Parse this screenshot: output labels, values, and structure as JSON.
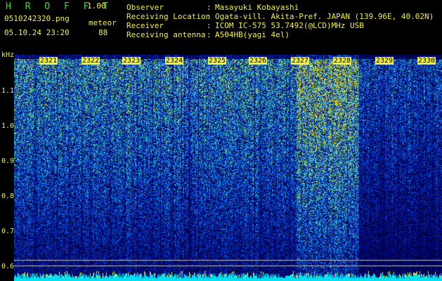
{
  "header": {
    "title": "H R O F F T",
    "version": "1.00",
    "filename": "0510242320.png",
    "mode": "meteor",
    "datetime": "05.10.24 23:20",
    "count": "88",
    "info": [
      {
        "key": "Observer",
        "value": "Masayuki Kobayashi"
      },
      {
        "key": "Receiving Location",
        "value": "Ogata-vill. Akita-Pref. JAPAN (139.96E, 40.02N)"
      },
      {
        "key": "Receiver",
        "value": "ICOM IC-575 53.7492(@LCD)MHz USB"
      },
      {
        "key": "Receiving antenna",
        "value": "A504HB(yagi 4el)"
      }
    ],
    "separator": ":"
  },
  "axis": {
    "y_unit": "kHz",
    "y_ticks": [
      "1.1",
      "1.0",
      "0.9",
      "0.8",
      "0.7",
      "0.6"
    ],
    "x_ticks": [
      "2321",
      "2322",
      "2323",
      "2324",
      "2325",
      "2326",
      "2327",
      "2328",
      "2329",
      "2330"
    ]
  },
  "colors": {
    "text": "#f0f040",
    "title": "#2de02d",
    "background": "#000000",
    "bottom_strip": "#00e0f0"
  }
}
